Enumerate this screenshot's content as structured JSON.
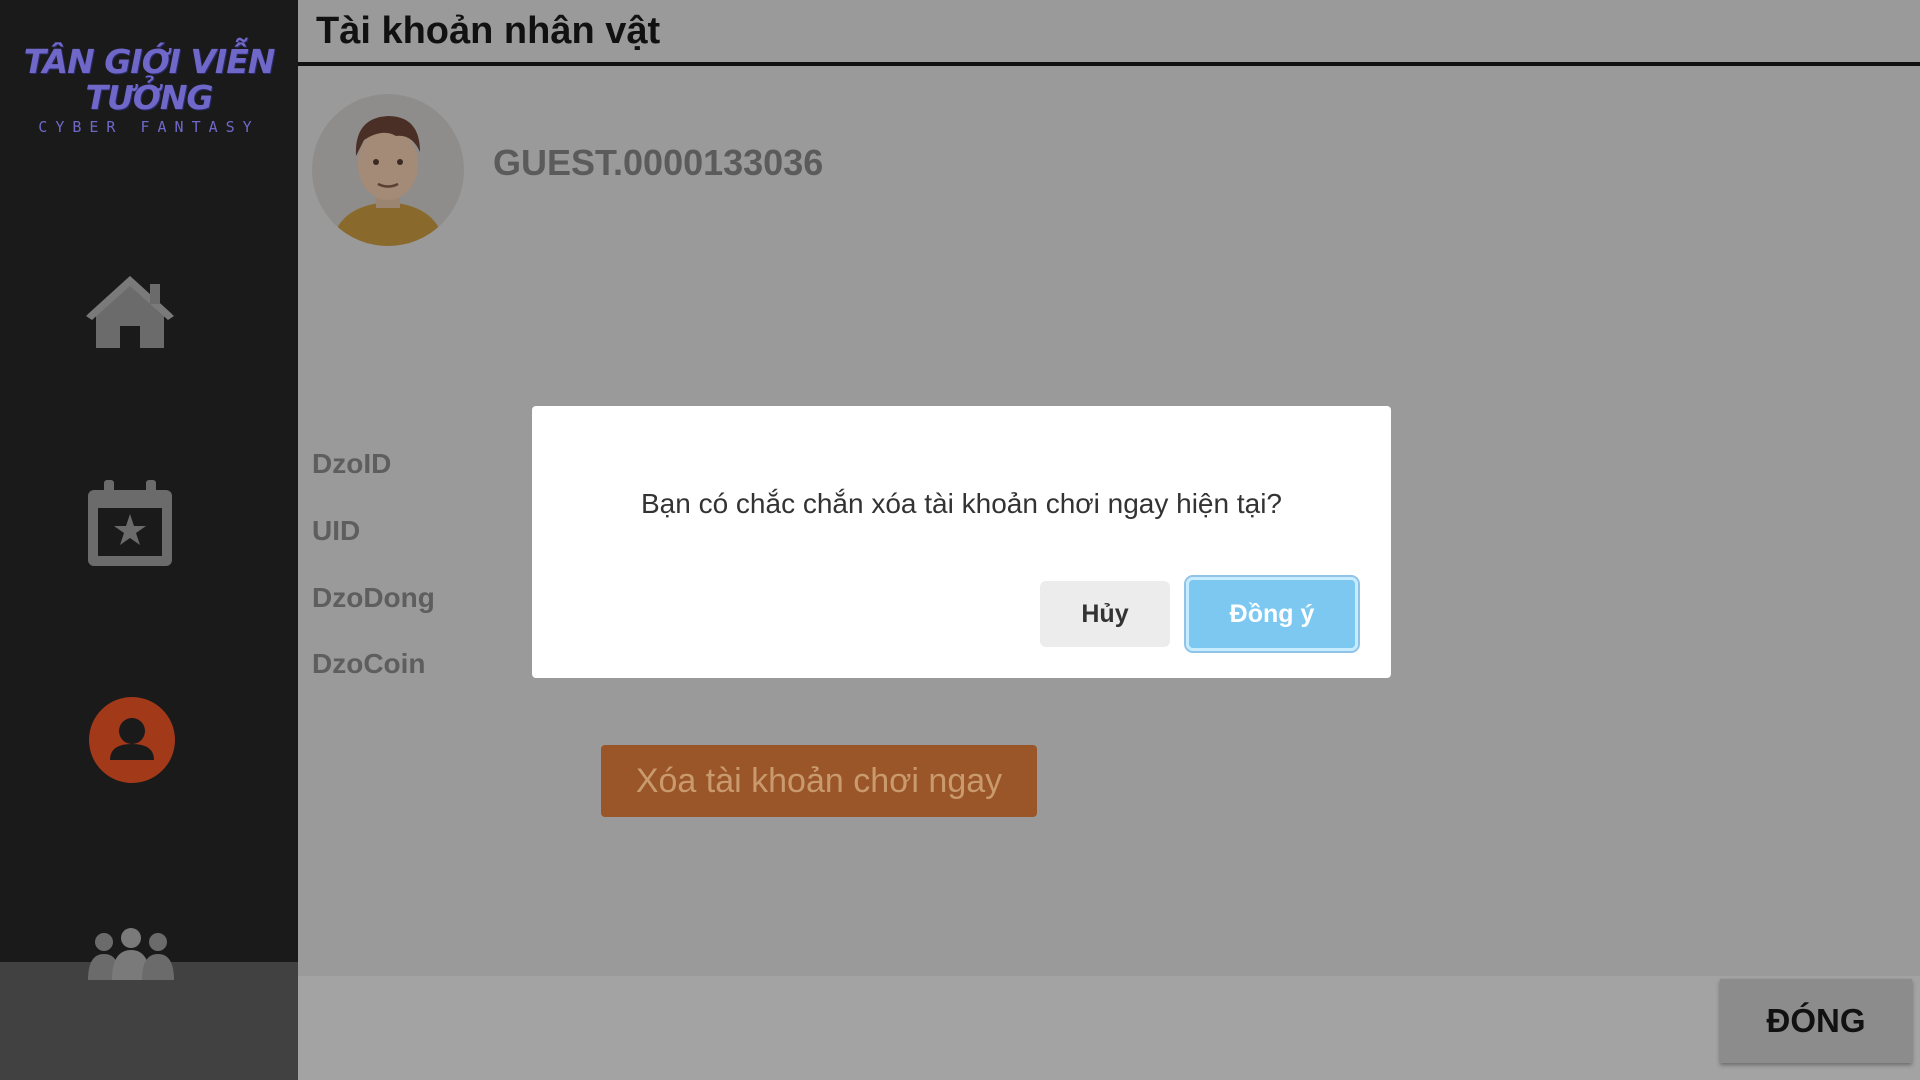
{
  "app": {
    "logo_title": "TÂN GIỚI VIỄN TƯỞNG",
    "logo_subtitle": "CYBER FANTASY"
  },
  "sidebar": {
    "items": [
      {
        "icon": "home-icon"
      },
      {
        "icon": "calendar-star-icon"
      },
      {
        "icon": "user-icon",
        "active": true,
        "accent": "#a23a1a"
      },
      {
        "icon": "group-icon"
      }
    ]
  },
  "header": {
    "title": "Tài khoản nhân vật"
  },
  "profile": {
    "username": "GUEST.0000133036",
    "avatar_icon": "avatar-icon"
  },
  "fields": {
    "dzoid": "DzoID",
    "uid": "UID",
    "dzodong": "DzoDong",
    "dzocoin": "DzoCoin"
  },
  "actions": {
    "delete_label": "Xóa tài khoản chơi ngay",
    "close_label": "ĐÓNG"
  },
  "dialog": {
    "message": "Bạn có chắc chắn xóa tài khoản chơi ngay hiện tại?",
    "cancel_label": "Hủy",
    "confirm_label": "Đồng ý"
  },
  "colors": {
    "sidebar_bg": "#1a1a1b",
    "overlay_bg": "#9a9a9a",
    "delete_button": "#9a5628",
    "confirm_button": "#7cc8f1",
    "active_nav": "#a23a1a"
  }
}
